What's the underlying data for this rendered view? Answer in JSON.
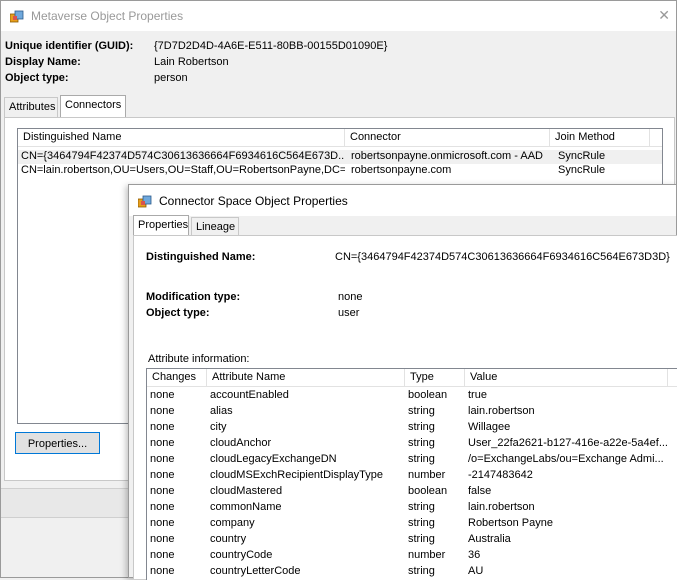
{
  "main_window": {
    "title": "Metaverse Object Properties",
    "close_glyph": "✕",
    "unique_id_label": "Unique identifier (GUID):",
    "unique_id_value": "{7D7D2D4D-4A6E-E511-80BB-00155D01090E}",
    "display_name_label": "Display Name:",
    "display_name_value": "Lain Robertson",
    "object_type_label": "Object type:",
    "object_type_value": "person",
    "tabs": [
      {
        "label": "Attributes",
        "active": false
      },
      {
        "label": "Connectors",
        "active": true
      }
    ],
    "connectors": {
      "columns": [
        "Distinguished Name",
        "Connector",
        "Join Method"
      ],
      "rows": [
        {
          "dn": "CN={3464794F42374D574C30613636664F6934616C564E673D...",
          "connector": "robertsonpayne.onmicrosoft.com - AAD",
          "join": "SyncRule"
        },
        {
          "dn": "CN=lain.robertson,OU=Users,OU=Staff,OU=RobertsonPayne,DC=...",
          "connector": "robertsonpayne.com",
          "join": "SyncRule"
        }
      ]
    },
    "properties_button": "Properties..."
  },
  "dialog": {
    "title": "Connector Space Object Properties",
    "tabs": [
      {
        "label": "Properties",
        "active": true
      },
      {
        "label": "Lineage",
        "active": false
      }
    ],
    "dn_label": "Distinguished Name:",
    "dn_value": "CN={3464794F42374D574C30613636664F6934616C564E673D3D}",
    "mod_type_label": "Modification type:",
    "mod_type_value": "none",
    "object_type_label": "Object type:",
    "object_type_value": "user",
    "attr_info_label": "Attribute information:",
    "grid": {
      "columns": [
        "Changes",
        "Attribute Name",
        "Type",
        "Value"
      ],
      "rows": [
        {
          "changes": "none",
          "name": "accountEnabled",
          "type": "boolean",
          "value": "true"
        },
        {
          "changes": "none",
          "name": "alias",
          "type": "string",
          "value": "lain.robertson"
        },
        {
          "changes": "none",
          "name": "city",
          "type": "string",
          "value": "Willagee"
        },
        {
          "changes": "none",
          "name": "cloudAnchor",
          "type": "string",
          "value": "User_22fa2621-b127-416e-a22e-5a4ef..."
        },
        {
          "changes": "none",
          "name": "cloudLegacyExchangeDN",
          "type": "string",
          "value": "/o=ExchangeLabs/ou=Exchange Admi..."
        },
        {
          "changes": "none",
          "name": "cloudMSExchRecipientDisplayType",
          "type": "number",
          "value": "-2147483642"
        },
        {
          "changes": "none",
          "name": "cloudMastered",
          "type": "boolean",
          "value": "false"
        },
        {
          "changes": "none",
          "name": "commonName",
          "type": "string",
          "value": "lain.robertson"
        },
        {
          "changes": "none",
          "name": "company",
          "type": "string",
          "value": "Robertson Payne"
        },
        {
          "changes": "none",
          "name": "country",
          "type": "string",
          "value": "Australia"
        },
        {
          "changes": "none",
          "name": "countryCode",
          "type": "number",
          "value": "36"
        },
        {
          "changes": "none",
          "name": "countryLetterCode",
          "type": "string",
          "value": "AU"
        }
      ]
    }
  },
  "colors": {
    "window_bg": "#f0f0f0",
    "selected_row": "#f0f0f0",
    "list_border": "#828790",
    "focus_border": "#0078d7"
  }
}
